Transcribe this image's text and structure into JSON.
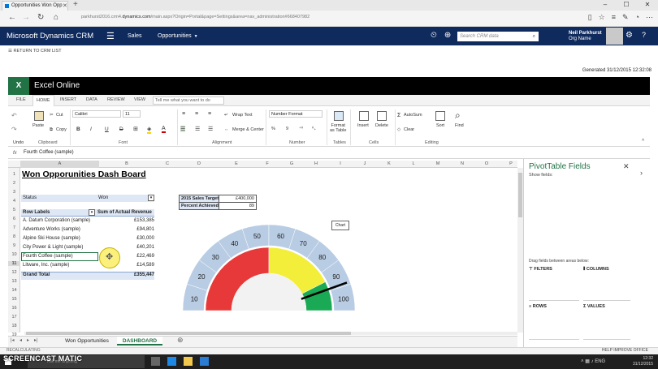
{
  "browser": {
    "tab_title": "Opportunities Won Opp",
    "url_prefix": "parkhurst2016.crm4.",
    "url_domain": "dynamics.com",
    "url_suffix": "/main.aspx?Origin=Portal&page=Settings&area=nav_administration#668407982"
  },
  "crm": {
    "title": "Microsoft Dynamics CRM",
    "nav_sales": "Sales",
    "nav_opportunities": "Opportunities",
    "search_placeholder": "Search CRM data",
    "user_name": "Neil Parkhurst",
    "org_name": "Org Name",
    "return_label": "RETURN TO CRM LIST",
    "generated": "Generated 31/12/2015 12:32:08"
  },
  "excel": {
    "app_title": "Excel Online",
    "ribbon_tabs": [
      "FILE",
      "HOME",
      "INSERT",
      "DATA",
      "REVIEW",
      "VIEW"
    ],
    "tell_me": "Tell me what you want to do",
    "ribbon": {
      "undo": "Undo",
      "paste": "Paste",
      "cut": "Cut",
      "copy": "Copy",
      "font_name": "Calibri",
      "font_size": "11",
      "bold": "B",
      "italic": "I",
      "underline": "U",
      "strike": "D",
      "wrap_text": "Wrap Text",
      "merge_center": "Merge & Center",
      "number_format": "Number Format",
      "currency": "%",
      "comma": "9",
      "format_as_table": "Format\nas Table",
      "insert": "Insert",
      "delete": "Delete",
      "autosum": "AutoSum",
      "clear": "Clear",
      "sort": "Sort",
      "find": "Find",
      "groups": [
        "Clipboard",
        "Font",
        "Alignment",
        "Number",
        "Tables",
        "Cells",
        "Editing"
      ]
    },
    "formula_bar": {
      "fx": "fx",
      "value": "Fourth Coffee (sample)"
    },
    "columns": [
      "A",
      "B",
      "C",
      "D",
      "E",
      "F",
      "G",
      "H",
      "I",
      "J",
      "K",
      "L",
      "M",
      "N",
      "O",
      "P"
    ],
    "rows": [
      "1",
      "2",
      "3",
      "4",
      "5",
      "6",
      "7",
      "8",
      "9",
      "10",
      "11",
      "12",
      "13",
      "14",
      "15",
      "16",
      "17",
      "18",
      "19"
    ],
    "dashboard_title": "Won Opporunities Dash Board",
    "filter": {
      "label": "Status",
      "value": "Won"
    },
    "pivot": {
      "row_header": "Row Labels",
      "value_header": "Sum of Actual Revenue",
      "rows": [
        {
          "label": "A. Datum Corporation (sample)",
          "value": "£153,385"
        },
        {
          "label": "Adventure Works (sample)",
          "value": "£94,801"
        },
        {
          "label": "Alpine Ski House (sample)",
          "value": "£30,000"
        },
        {
          "label": "City Power & Light (sample)",
          "value": "£40,201"
        },
        {
          "label": "Fourth Coffee (sample)",
          "value": "£22,469"
        },
        {
          "label": "Litware, Inc. (sample)",
          "value": "£14,589"
        }
      ],
      "total_label": "Grand Total",
      "total_value": "£355,447"
    },
    "target_table": [
      {
        "label": "2015 Sales Target",
        "value": "£400,000"
      },
      {
        "label": "Percent Achieved",
        "value": "89"
      }
    ],
    "chart_label": "Chart",
    "sheet_tabs": [
      "Won Opportunities",
      "DASHBOARD"
    ],
    "active_sheet": "DASHBOARD",
    "status_left": "RECALCULATING",
    "status_right": "HELP IMPROVE OFFICE"
  },
  "chart_data": {
    "type": "gauge",
    "min": 0,
    "max": 100,
    "value": 89,
    "ticks": [
      "10",
      "20",
      "30",
      "40",
      "50",
      "60",
      "70",
      "80",
      "90",
      "100"
    ],
    "bands": [
      {
        "from": 0,
        "to": 50,
        "color": "#e8393a"
      },
      {
        "from": 50,
        "to": 85,
        "color": "#f3ee3a"
      },
      {
        "from": 85,
        "to": 100,
        "color": "#1aaa55"
      }
    ],
    "ring_color": "#b8cce4"
  },
  "pivot_pane": {
    "title": "PivotTable Fields",
    "show_fields": "Show fields:",
    "drag_hint": "Drag fields between areas below:",
    "filters": "FILTERS",
    "columns": "COLUMNS",
    "rows": "ROWS",
    "values": "VALUES"
  },
  "taskbar": {
    "search": "Ask me anything",
    "watermark": "SCREENCAST   MATIC",
    "time": "12:32",
    "date": "31/12/2015",
    "lang": "ENG"
  }
}
